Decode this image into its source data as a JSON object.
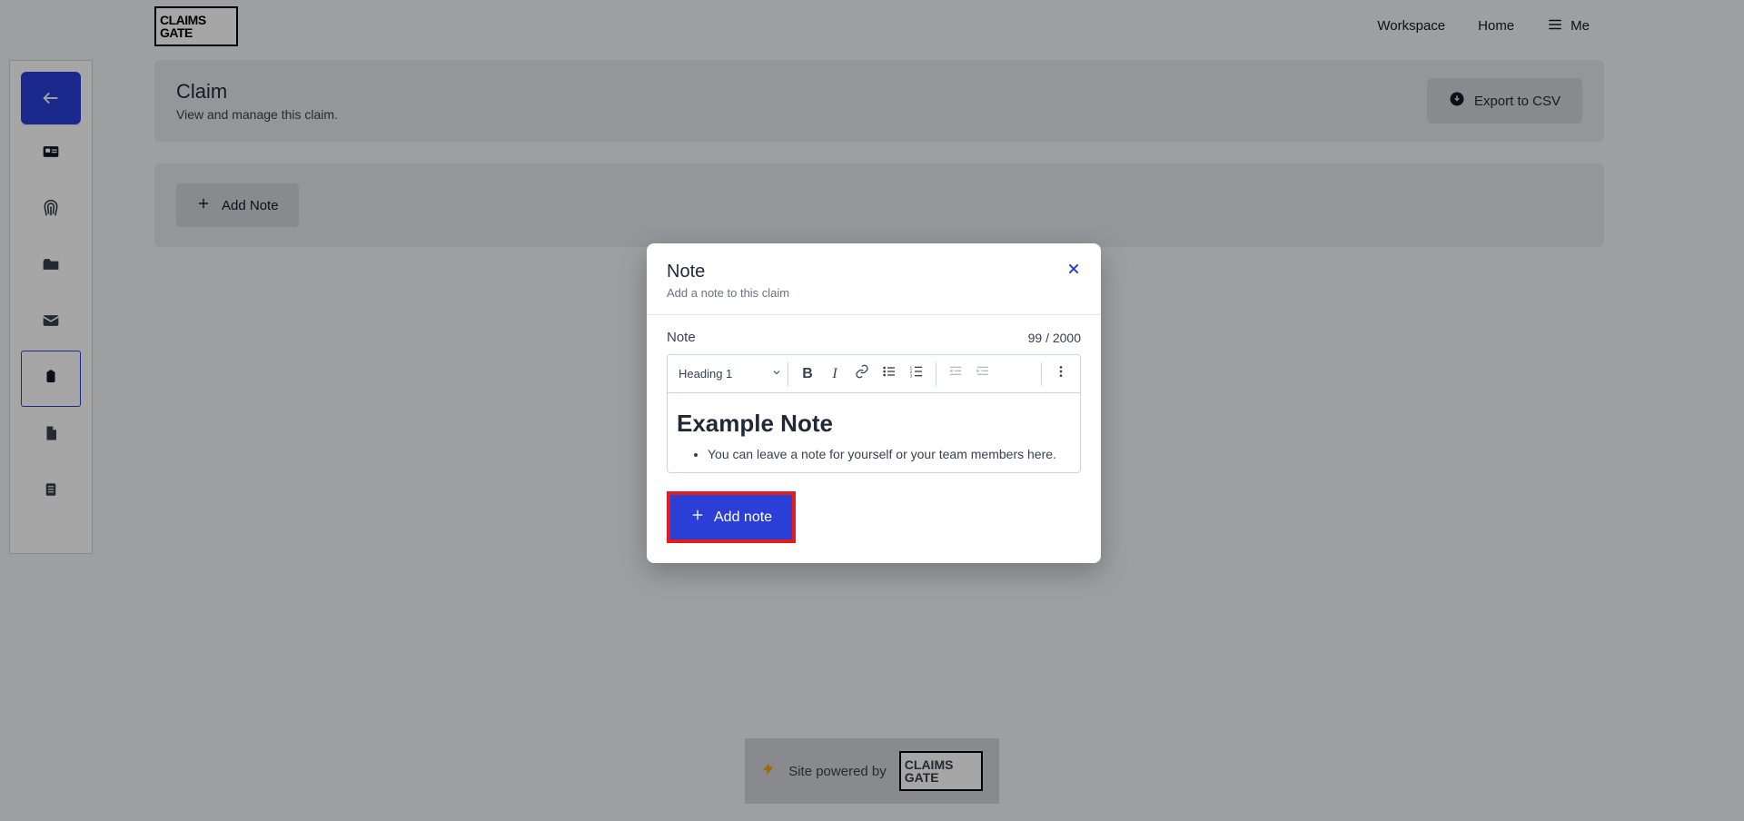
{
  "logo": {
    "line1": "CLAIMS",
    "line2": "GATE"
  },
  "nav": {
    "workspace": "Workspace",
    "home": "Home",
    "me": "Me"
  },
  "claim": {
    "title": "Claim",
    "subtitle": "View and manage this claim.",
    "export_label": "Export to CSV",
    "add_note_label": "Add Note"
  },
  "footer": {
    "powered": "Site powered by"
  },
  "modal": {
    "title": "Note",
    "subtitle": "Add a note to this claim",
    "field_label": "Note",
    "count": "99 / 2000",
    "heading_option": "Heading 1",
    "content_h1": "Example Note",
    "content_li": "You can leave a note for yourself or your team members here.",
    "submit_label": "Add note"
  }
}
